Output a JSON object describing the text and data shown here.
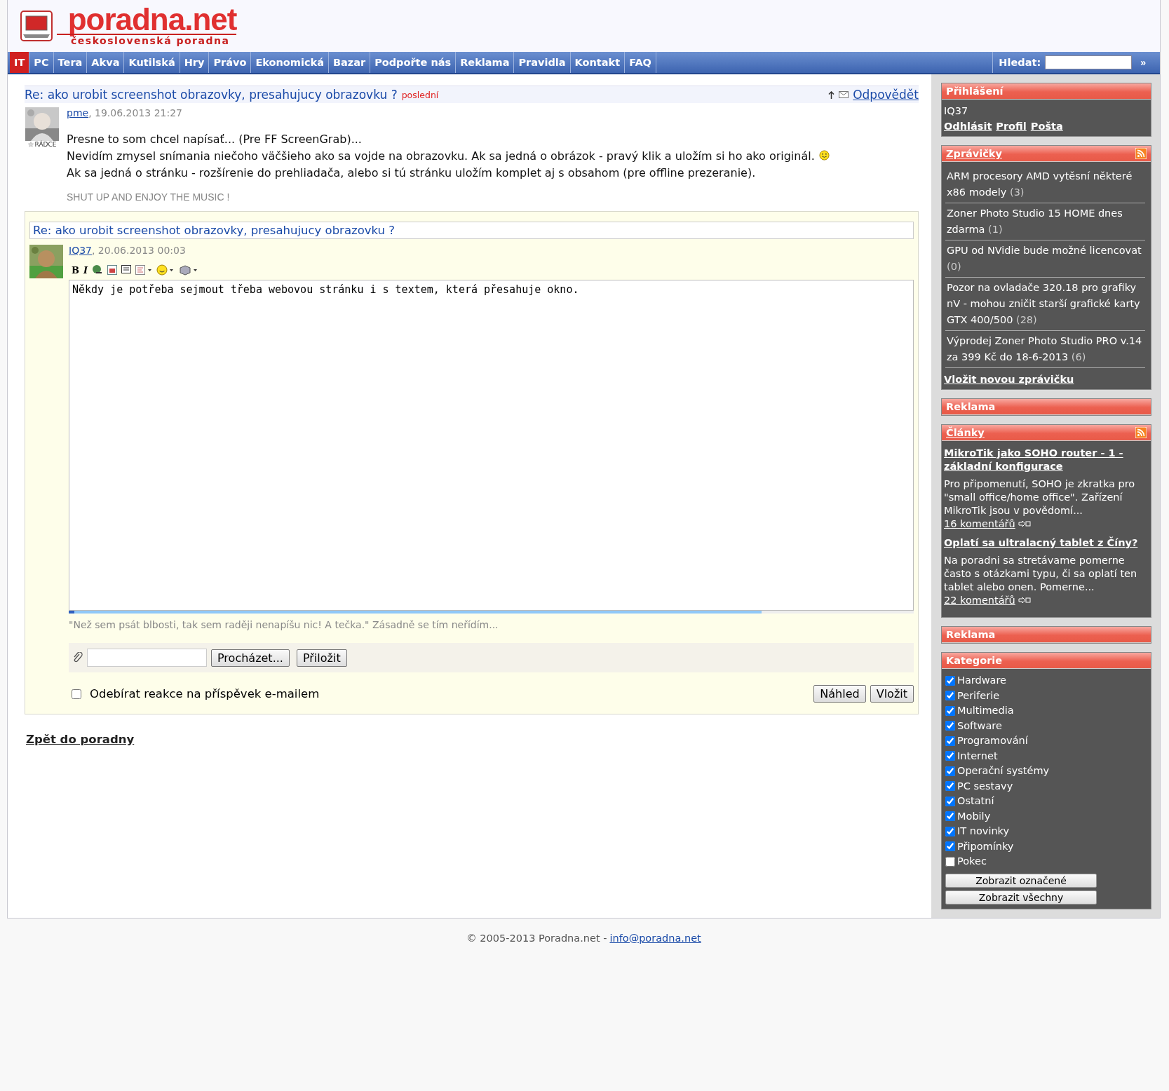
{
  "logo": {
    "name": "poradna.net",
    "tagline": "československá poradna"
  },
  "nav": {
    "items": [
      {
        "label": "IT",
        "selected": true
      },
      {
        "label": "PC",
        "selected": false
      },
      {
        "label": "Tera",
        "selected": false
      },
      {
        "label": "Akva",
        "selected": false
      },
      {
        "label": "Kutilská",
        "selected": false
      },
      {
        "label": "Hry",
        "selected": false
      },
      {
        "label": "Právo",
        "selected": false
      },
      {
        "label": "Ekonomická",
        "selected": false
      },
      {
        "label": "Bazar",
        "selected": false
      },
      {
        "label": "Podpořte nás",
        "selected": false
      },
      {
        "label": "Reklama",
        "selected": false
      },
      {
        "label": "Pravidla",
        "selected": false
      },
      {
        "label": "Kontakt",
        "selected": false
      },
      {
        "label": "FAQ",
        "selected": false
      }
    ],
    "search": {
      "label": "Hledat:",
      "button": "»"
    }
  },
  "post": {
    "title": "Re: ako urobit screenshot obrazovky, presahujucy obrazovku ?",
    "tag": "poslední",
    "reply": "Odpovědět",
    "author": "pme",
    "date": ", 19.06.2013 21:27",
    "badge": "RÁDCE",
    "lines": [
      {
        "text": "Presne to som chcel napísať... (Pre FF ScreenGrab)...",
        "smiley": false
      },
      {
        "text": "Nevidím zmysel snímania niečoho väčšieho ako sa vojde na obrazovku. Ak sa jedná o obrázok - pravý klik a uložím si ho ako originál.",
        "smiley": true
      },
      {
        "text": "Ak sa jedná o stránku - rozšírenie do prehliadača, alebo si tú stránku uložím komplet aj s obsahom (pre offline prezeranie).",
        "smiley": false
      }
    ],
    "signature": "SHUT UP AND ENJOY THE MUSIC !"
  },
  "reply_form": {
    "subject": "Re: ako urobit screenshot obrazovky, presahujucy obrazovku ?",
    "author": "IQ37",
    "date": ", 20.06.2013 00:03",
    "toolbar": [
      "B",
      "I"
    ],
    "text": "Někdy je potřeba sejmout třeba webovou stránku i s textem, která přesahuje okno.",
    "length_meter": {
      "level": 0.82
    },
    "signature": "\"Než sem psát blbosti, tak sem raději nenapíšu nic! A tečka.\" Zásadně se tím neřídím...",
    "browse_button": "Procházet...",
    "attach_button": "Přiložit",
    "subscribe": {
      "label": "Odebírat reakce na příspěvek e-mailem",
      "checked": false
    },
    "preview_button": "Náhled",
    "submit_button": "Vložit"
  },
  "back_link": "Zpět do poradny",
  "sidebar": {
    "login": {
      "title": "Přihlášení",
      "user": "IQ37",
      "links": [
        "Odhlásit",
        "Profil",
        "Pošta"
      ]
    },
    "news": {
      "title": "Zprávičky",
      "items": [
        {
          "text": "ARM procesory AMD vytěsní některé x86 modely",
          "count": "(3)"
        },
        {
          "text": "Zoner Photo Studio 15 HOME dnes zdarma",
          "count": "(1)"
        },
        {
          "text": "GPU od NVidie bude možné licencovat",
          "count": "(0)"
        },
        {
          "text": "Pozor na ovladače 320.18 pro grafiky nV - mohou zničit starší grafické karty GTX 400/500",
          "count": "(28)"
        },
        {
          "text": "Výprodej Zoner Photo Studio PRO v.14 za 399 Kč do 18-6-2013",
          "count": "(6)"
        }
      ],
      "add_link": "Vložit novou zprávičku"
    },
    "ad_top": {
      "title": "Reklama"
    },
    "articles": {
      "title": "Články",
      "items": [
        {
          "title": "MikroTik jako SOHO router - 1 - základní konfigurace",
          "summary": "Pro připomenutí, SOHO je zkratka pro \"small office/home office\". Zařízení MikroTik jsou v povědomí...",
          "comments": "16 komentářů"
        },
        {
          "title": "Oplatí sa ultralacný tablet z Číny?",
          "summary": "Na poradni sa stretávame pomerne často s otázkami typu, či sa oplatí ten tablet alebo onen. Pomerne...",
          "comments": "22 komentářů"
        }
      ]
    },
    "ad_bottom": {
      "title": "Reklama"
    },
    "categories": {
      "title": "Kategorie",
      "items": [
        {
          "label": "Hardware",
          "checked": true
        },
        {
          "label": "Periferie",
          "checked": true
        },
        {
          "label": "Multimedia",
          "checked": true
        },
        {
          "label": "Software",
          "checked": true
        },
        {
          "label": "Programování",
          "checked": true
        },
        {
          "label": "Internet",
          "checked": true
        },
        {
          "label": "Operační systémy",
          "checked": true
        },
        {
          "label": "PC sestavy",
          "checked": true
        },
        {
          "label": "Ostatní",
          "checked": true
        },
        {
          "label": "Mobily",
          "checked": true
        },
        {
          "label": "IT novinky",
          "checked": true
        },
        {
          "label": "Připomínky",
          "checked": true
        },
        {
          "label": "Pokec",
          "checked": false
        }
      ],
      "buttons": [
        "Zobrazit označené",
        "Zobrazit všechny"
      ]
    }
  },
  "footer": {
    "copyright": "© 2005-2013 Poradna.net -",
    "email": "info@poradna.net"
  }
}
